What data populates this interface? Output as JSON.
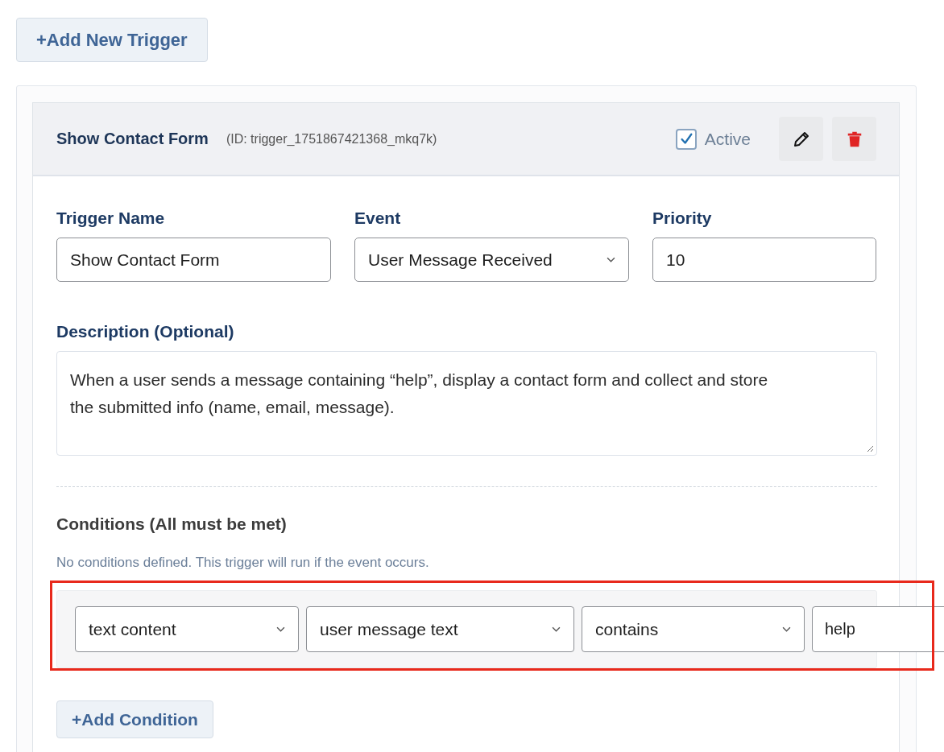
{
  "add_trigger_button": {
    "label": "+Add New Trigger"
  },
  "trigger": {
    "title": "Show Contact Form",
    "id_text": "(ID: trigger_1751867421368_mkq7k)",
    "active": {
      "label": "Active",
      "checked": true
    },
    "fields": [
      {
        "kind": "input",
        "label": "Trigger Name",
        "value": "Show Contact Form"
      },
      {
        "kind": "select",
        "label": "Event",
        "value": "User Message Received"
      },
      {
        "kind": "input",
        "label": "Priority",
        "value": "10"
      }
    ],
    "description": {
      "label": "Description (Optional)",
      "value": "When a user sends a message containing “help”, display a contact form and collect and store the submitted info (name, email, message)."
    },
    "conditions": {
      "heading": "Conditions (All must be met)",
      "note": "No conditions defined. This trigger will run if the event occurs.",
      "highlighted": true,
      "row": [
        {
          "kind": "select",
          "value": "text content"
        },
        {
          "kind": "select",
          "value": "user message text"
        },
        {
          "kind": "select",
          "value": "contains"
        },
        {
          "kind": "input",
          "value": "help"
        }
      ]
    },
    "add_condition_button": {
      "label": "+Add Condition"
    }
  }
}
